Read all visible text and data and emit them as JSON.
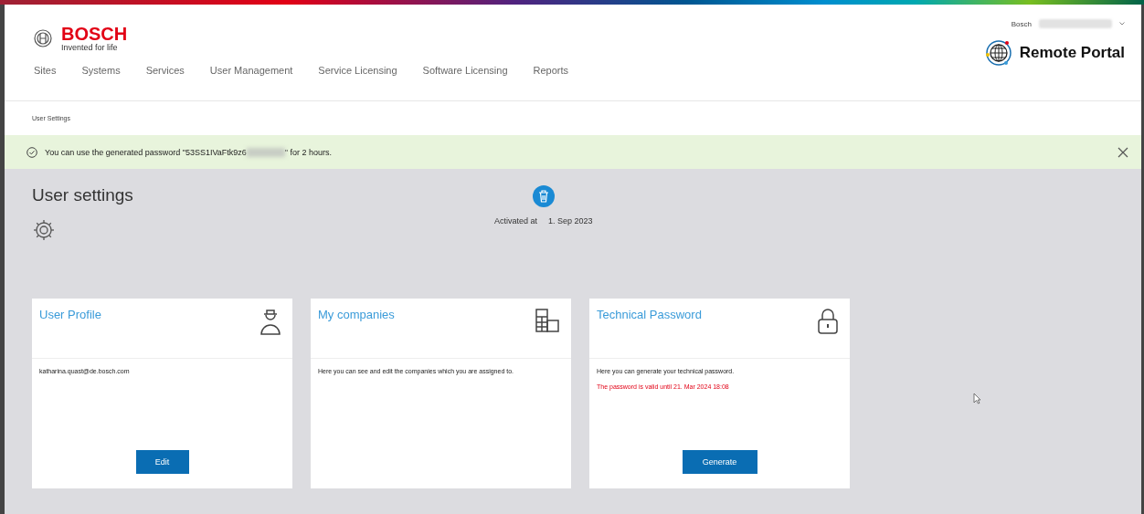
{
  "header": {
    "brand": "BOSCH",
    "tagline": "Invented for life",
    "account": "Bosch",
    "portal_title": "Remote Portal"
  },
  "nav": [
    {
      "label": "Sites"
    },
    {
      "label": "Systems"
    },
    {
      "label": "Services"
    },
    {
      "label": "User Management"
    },
    {
      "label": "Service Licensing"
    },
    {
      "label": "Software Licensing"
    },
    {
      "label": "Reports"
    }
  ],
  "breadcrumb": "User Settings",
  "banner": {
    "text_before": "You can use the generated password \"53SS1IVaFtk9z6",
    "text_after": "\" for 2 hours."
  },
  "page_title": "User settings",
  "activated": {
    "label": "Activated at",
    "date": "1. Sep 2023"
  },
  "cards": [
    {
      "title": "User Profile",
      "kind": "person",
      "text": "katharina.quast@de.bosch.com",
      "button": "Edit"
    },
    {
      "title": "My companies",
      "kind": "building",
      "text": "Here you can see and edit the companies which you are assigned to."
    },
    {
      "title": "Technical Password",
      "kind": "lock",
      "text": "Here you can generate your technical password.",
      "note": "The password is valid until 21. Mar 2024 18:08",
      "button": "Generate"
    }
  ]
}
